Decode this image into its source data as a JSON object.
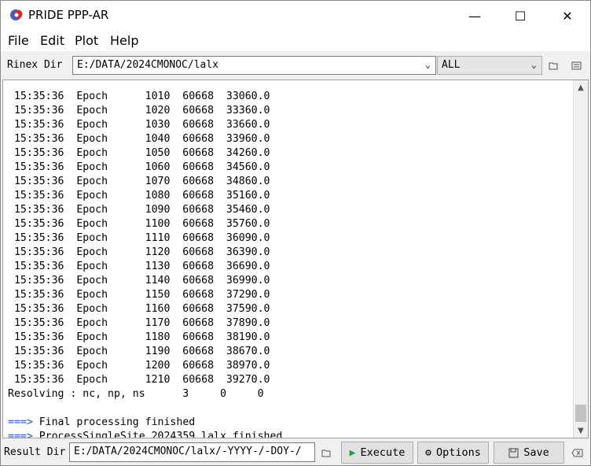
{
  "window": {
    "title": "PRIDE PPP-AR",
    "minimize_glyph": "—",
    "maximize_glyph": "☐",
    "close_glyph": "✕"
  },
  "menu": [
    "File",
    "Edit",
    "Plot",
    "Help"
  ],
  "toolbar": {
    "rinex_label": "Rinex Dir",
    "rinex_value": "E:/DATA/2024CMONOC/lalx",
    "filter_value": "ALL",
    "icons": [
      "folder-open-icon",
      "list-icon"
    ]
  },
  "log": {
    "epochs": [
      [
        "15:35:36",
        "Epoch",
        "1010",
        "60668",
        "33060.0"
      ],
      [
        "15:35:36",
        "Epoch",
        "1020",
        "60668",
        "33360.0"
      ],
      [
        "15:35:36",
        "Epoch",
        "1030",
        "60668",
        "33660.0"
      ],
      [
        "15:35:36",
        "Epoch",
        "1040",
        "60668",
        "33960.0"
      ],
      [
        "15:35:36",
        "Epoch",
        "1050",
        "60668",
        "34260.0"
      ],
      [
        "15:35:36",
        "Epoch",
        "1060",
        "60668",
        "34560.0"
      ],
      [
        "15:35:36",
        "Epoch",
        "1070",
        "60668",
        "34860.0"
      ],
      [
        "15:35:36",
        "Epoch",
        "1080",
        "60668",
        "35160.0"
      ],
      [
        "15:35:36",
        "Epoch",
        "1090",
        "60668",
        "35460.0"
      ],
      [
        "15:35:36",
        "Epoch",
        "1100",
        "60668",
        "35760.0"
      ],
      [
        "15:35:36",
        "Epoch",
        "1110",
        "60668",
        "36090.0"
      ],
      [
        "15:35:36",
        "Epoch",
        "1120",
        "60668",
        "36390.0"
      ],
      [
        "15:35:36",
        "Epoch",
        "1130",
        "60668",
        "36690.0"
      ],
      [
        "15:35:36",
        "Epoch",
        "1140",
        "60668",
        "36990.0"
      ],
      [
        "15:35:36",
        "Epoch",
        "1150",
        "60668",
        "37290.0"
      ],
      [
        "15:35:36",
        "Epoch",
        "1160",
        "60668",
        "37590.0"
      ],
      [
        "15:35:36",
        "Epoch",
        "1170",
        "60668",
        "37890.0"
      ],
      [
        "15:35:36",
        "Epoch",
        "1180",
        "60668",
        "38190.0"
      ],
      [
        "15:35:36",
        "Epoch",
        "1190",
        "60668",
        "38670.0"
      ],
      [
        "15:35:36",
        "Epoch",
        "1200",
        "60668",
        "38970.0"
      ],
      [
        "15:35:36",
        "Epoch",
        "1210",
        "60668",
        "39270.0"
      ]
    ],
    "resolving": "Resolving : nc, np, ns      3     0     0",
    "messages": [
      {
        "prefix": "===>",
        "text": " Final processing finished"
      },
      {
        "prefix": "===>",
        "text": " ProcessSingleSite 2024359 lalx finished"
      }
    ]
  },
  "bottom": {
    "result_label": "Result Dir",
    "result_value": "E:/DATA/2024CMONOC/lalx/-YYYY-/-DOY-/",
    "execute_label": "Execute",
    "options_label": "Options",
    "save_label": "Save"
  },
  "colors": {
    "execute_icon": "#1e9e3a",
    "prompt_arrow": "#2550c8",
    "app_icon_red": "#d0302a",
    "app_icon_blue": "#3a5fd0"
  }
}
